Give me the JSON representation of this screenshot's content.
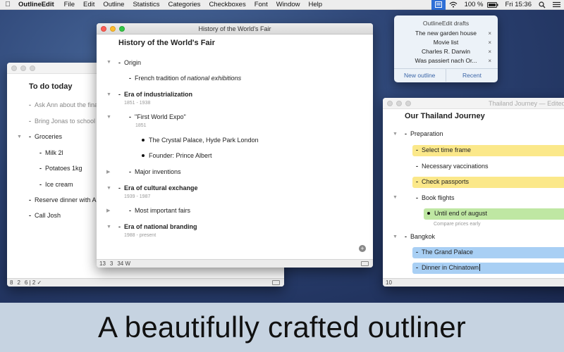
{
  "menubar": {
    "app_name": "OutlineEdit",
    "items": [
      "File",
      "Edit",
      "Outline",
      "Statistics",
      "Categories",
      "Checkboxes",
      "Font",
      "Window",
      "Help"
    ],
    "battery": "100 %",
    "clock": "Fri 15:36",
    "icons": [
      "apple-icon",
      "drafts-menu-icon",
      "wifi-icon",
      "battery-icon",
      "search-icon",
      "menu-list-icon"
    ]
  },
  "drafts_popup": {
    "title": "OutlineEdit drafts",
    "items": [
      "The new garden house",
      "Movie list",
      "Charles R. Darwin",
      "Was passiert nach Or..."
    ],
    "remove_glyph": "×",
    "new_outline": "New outline",
    "recent": "Recent"
  },
  "todo_window": {
    "heading": "To do today",
    "items": [
      {
        "text": "Ask Ann about the fina",
        "style": "gray"
      },
      {
        "text": "Bring Jonas to school",
        "style": "gray"
      },
      {
        "text": "Groceries",
        "style": "normal"
      },
      {
        "text": "Milk 2l",
        "style": "normal"
      },
      {
        "text": "Potatoes 1kg",
        "style": "normal"
      },
      {
        "text": "Ice cream",
        "style": "normal"
      },
      {
        "text": "Reserve dinner with An",
        "style": "normal"
      },
      {
        "text": "Call Josh",
        "style": "normal"
      }
    ],
    "status": [
      "8",
      "2",
      "6 | 2 ✓"
    ]
  },
  "history_window": {
    "title": "History of the World's Fair",
    "heading": "History of the World's Fair",
    "rows": {
      "origin": "Origin",
      "french_pre": "French tradition of ",
      "french_em": "national exhibitions",
      "industrial": "Era of industrialization",
      "industrial_note": "1851 - 1938",
      "first_expo": "\"First World Expo\"",
      "first_expo_note": "1851",
      "crystal": "The Crystal Palace, Hyde Park London",
      "founder": "Founder: Prince Albert",
      "inventions": "Major inventions",
      "cultural": "Era of cultural exchange",
      "cultural_note": "1939 - 1987",
      "fairs": "Most important fairs",
      "branding": "Era of national branding",
      "branding_note": "1988 - present"
    },
    "status": [
      "13",
      "3",
      "34 W"
    ]
  },
  "thailand_window": {
    "title": "Thailand Journey",
    "edited": "— Edited",
    "heading": "Our Thailand Journey",
    "rows": {
      "preparation": "Preparation",
      "time_frame": "Select time frame",
      "vaccinations": "Necessary vaccinations",
      "passports": "Check passports",
      "flights": "Book flights",
      "until": "Until end of august",
      "compare": "Compare prices early",
      "bangkok": "Bangkok",
      "palace": "The Grand Palace",
      "dinner": "Dinner in Chinatown"
    },
    "status": "10",
    "highlight_colors": {
      "yellow": "#fbe88a",
      "green": "#bfe7a3",
      "blue": "#a8cff4"
    }
  },
  "tagline": "A beautifully crafted outliner"
}
